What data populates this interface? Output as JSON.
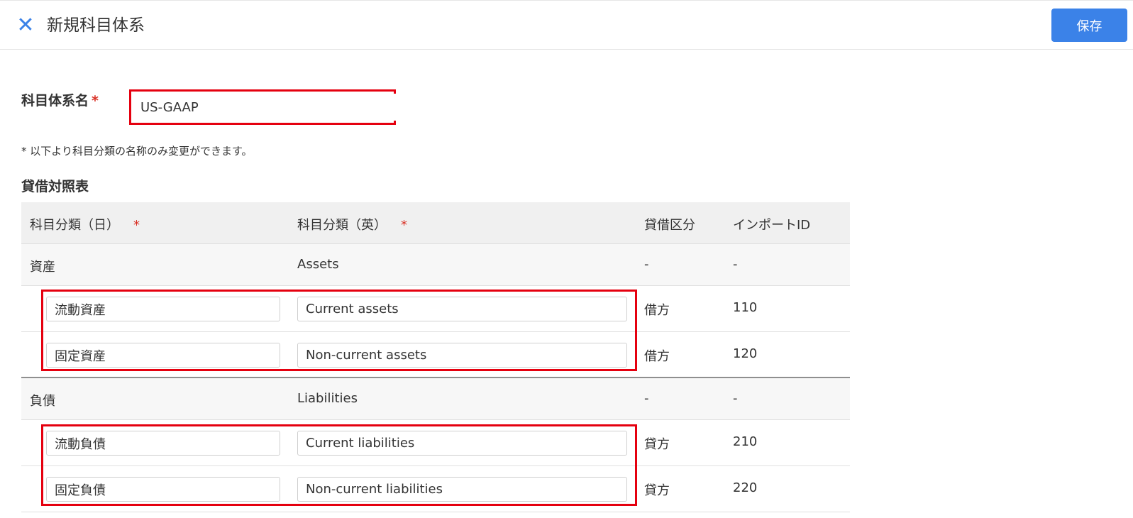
{
  "header": {
    "close_icon": "close-icon",
    "title": "新規科目体系",
    "save_label": "保存"
  },
  "form": {
    "name_label": "科目体系名",
    "required_mark": "*",
    "name_value": "US-GAAP",
    "note": "* 以下より科目分類の名称のみ変更ができます。"
  },
  "section": {
    "title": "貸借対照表"
  },
  "table": {
    "columns": {
      "ja": "科目分類（日）",
      "ja_req": "*",
      "en": "科目分類（英）",
      "en_req": "*",
      "side": "貸借区分",
      "import_id": "インポートID"
    },
    "groups": [
      {
        "ja": "資産",
        "en": "Assets",
        "side": "-",
        "import_id": "-",
        "children": [
          {
            "ja": "流動資産",
            "en": "Current assets",
            "side": "借方",
            "import_id": "110"
          },
          {
            "ja": "固定資産",
            "en": "Non-current assets",
            "side": "借方",
            "import_id": "120"
          }
        ]
      },
      {
        "ja": "負債",
        "en": "Liabilities",
        "side": "-",
        "import_id": "-",
        "children": [
          {
            "ja": "流動負債",
            "en": "Current liabilities",
            "side": "貸方",
            "import_id": "210"
          },
          {
            "ja": "固定負債",
            "en": "Non-current liabilities",
            "side": "貸方",
            "import_id": "220"
          }
        ]
      }
    ]
  },
  "colors": {
    "accent": "#3b82e8",
    "highlight": "#e5000f",
    "required": "#d93025"
  }
}
